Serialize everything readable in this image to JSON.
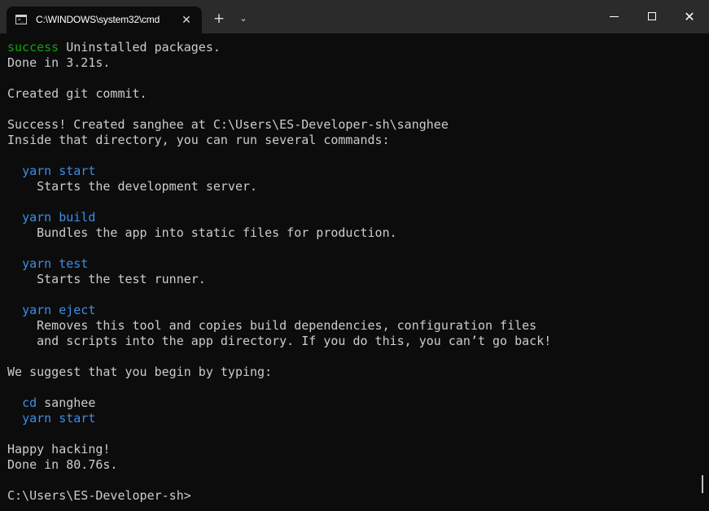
{
  "window": {
    "tab_title": "C:\\WINDOWS\\system32\\cmd",
    "tab_icon": "console-icon",
    "new_tab": "+",
    "dropdown": "⌄",
    "close_tab": "✕",
    "minimize": "minimize-icon",
    "maximize": "maximize-icon",
    "close_window": "✕"
  },
  "terminal": {
    "lines": [
      {
        "parts": [
          {
            "t": "success",
            "c": "green"
          },
          {
            "t": " Uninstalled packages.",
            "c": ""
          }
        ]
      },
      {
        "parts": [
          {
            "t": "Done in 3.21s.",
            "c": ""
          }
        ]
      },
      {
        "parts": [
          {
            "t": "",
            "c": ""
          }
        ]
      },
      {
        "parts": [
          {
            "t": "Created git commit.",
            "c": ""
          }
        ]
      },
      {
        "parts": [
          {
            "t": "",
            "c": ""
          }
        ]
      },
      {
        "parts": [
          {
            "t": "Success! Created sanghee at C:\\Users\\ES-Developer-sh\\sanghee",
            "c": ""
          }
        ]
      },
      {
        "parts": [
          {
            "t": "Inside that directory, you can run several commands:",
            "c": ""
          }
        ]
      },
      {
        "parts": [
          {
            "t": "",
            "c": ""
          }
        ]
      },
      {
        "parts": [
          {
            "t": "  ",
            "c": ""
          },
          {
            "t": "yarn start",
            "c": "blue"
          }
        ]
      },
      {
        "parts": [
          {
            "t": "    Starts the development server.",
            "c": ""
          }
        ]
      },
      {
        "parts": [
          {
            "t": "",
            "c": ""
          }
        ]
      },
      {
        "parts": [
          {
            "t": "  ",
            "c": ""
          },
          {
            "t": "yarn build",
            "c": "blue"
          }
        ]
      },
      {
        "parts": [
          {
            "t": "    Bundles the app into static files for production.",
            "c": ""
          }
        ]
      },
      {
        "parts": [
          {
            "t": "",
            "c": ""
          }
        ]
      },
      {
        "parts": [
          {
            "t": "  ",
            "c": ""
          },
          {
            "t": "yarn test",
            "c": "blue"
          }
        ]
      },
      {
        "parts": [
          {
            "t": "    Starts the test runner.",
            "c": ""
          }
        ]
      },
      {
        "parts": [
          {
            "t": "",
            "c": ""
          }
        ]
      },
      {
        "parts": [
          {
            "t": "  ",
            "c": ""
          },
          {
            "t": "yarn eject",
            "c": "blue"
          }
        ]
      },
      {
        "parts": [
          {
            "t": "    Removes this tool and copies build dependencies, configuration files",
            "c": ""
          }
        ]
      },
      {
        "parts": [
          {
            "t": "    and scripts into the app directory. If you do this, you can’t go back!",
            "c": ""
          }
        ]
      },
      {
        "parts": [
          {
            "t": "",
            "c": ""
          }
        ]
      },
      {
        "parts": [
          {
            "t": "We suggest that you begin by typing:",
            "c": ""
          }
        ]
      },
      {
        "parts": [
          {
            "t": "",
            "c": ""
          }
        ]
      },
      {
        "parts": [
          {
            "t": "  ",
            "c": ""
          },
          {
            "t": "cd",
            "c": "blue"
          },
          {
            "t": " sanghee",
            "c": ""
          }
        ]
      },
      {
        "parts": [
          {
            "t": "  ",
            "c": ""
          },
          {
            "t": "yarn start",
            "c": "blue"
          }
        ]
      },
      {
        "parts": [
          {
            "t": "",
            "c": ""
          }
        ]
      },
      {
        "parts": [
          {
            "t": "Happy hacking!",
            "c": ""
          }
        ]
      },
      {
        "parts": [
          {
            "t": "Done in 80.76s.",
            "c": ""
          }
        ]
      },
      {
        "parts": [
          {
            "t": "",
            "c": ""
          }
        ]
      },
      {
        "parts": [
          {
            "t": "C:\\Users\\ES-Developer-sh>",
            "c": ""
          }
        ]
      }
    ]
  },
  "colors": {
    "background": "#0c0c0c",
    "titlebar": "#2b2b2b",
    "text": "#cccccc",
    "success_green": "#13a10e",
    "command_blue": "#3b8eea"
  }
}
